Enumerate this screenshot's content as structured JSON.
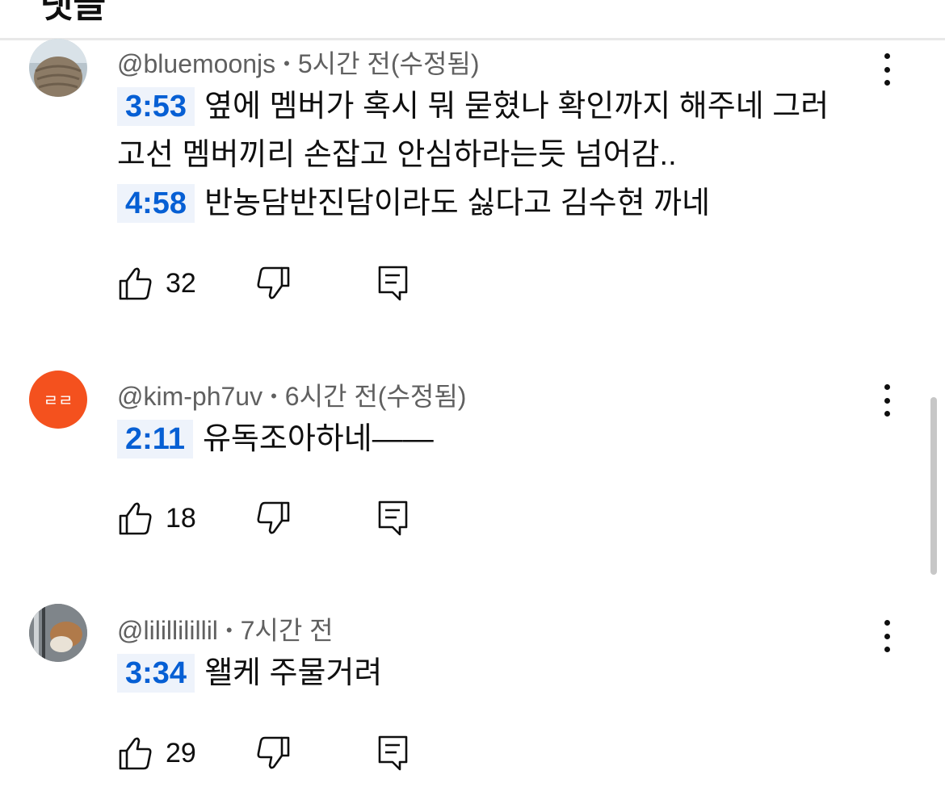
{
  "header": {
    "title": "댓글"
  },
  "comments": [
    {
      "author": "@bluemoonjs",
      "time": "5시간 전(수정됨)",
      "lines": [
        {
          "timestamp": "3:53",
          "text": "옆에 멤버가 혹시 뭐 묻혔나 확인까지 해주네 그러"
        },
        {
          "timestamp": "",
          "text": "고선 멤버끼리 손잡고 안심하라는듯 넘어감.."
        },
        {
          "timestamp": "4:58",
          "text": "반농담반진담이라도 싫다고 김수현 까네"
        }
      ],
      "likes": "32",
      "avatar": "photo-stone-wall"
    },
    {
      "author": "@kim-ph7uv",
      "time": "6시간 전(수정됨)",
      "lines": [
        {
          "timestamp": "2:11",
          "text": "유독조아하네——"
        }
      ],
      "likes": "18",
      "avatar": "initials-orange",
      "avatar_text": "ㄹㄹ",
      "avatar_color": "#f4511e"
    },
    {
      "author": "@lilillilillil",
      "time": "7시간 전",
      "lines": [
        {
          "timestamp": "3:34",
          "text": "왤케 주물거려"
        }
      ],
      "likes": "29",
      "avatar": "photo-animal"
    }
  ],
  "separator": "•",
  "colors": {
    "timestamp": "#065fd4",
    "timestamp_bg": "#eef3fb",
    "meta": "#606060"
  }
}
